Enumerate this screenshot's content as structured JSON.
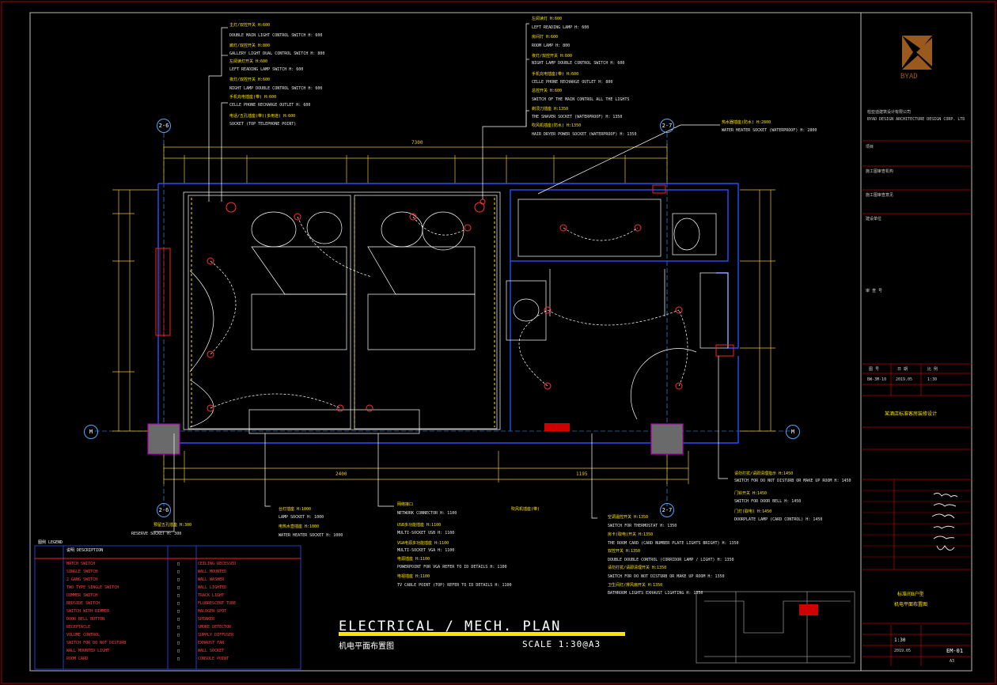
{
  "drawing": {
    "title_en": "ELECTRICAL / MECH. PLAN",
    "title_cn": "机电平面布置图",
    "scale": "SCALE 1:30@A3"
  },
  "grid_labels": {
    "top_left": "2-6",
    "top_right": "2-7",
    "bottom_left": "2-6",
    "bottom_right": "2-7",
    "left_m": "M",
    "right_m": "M"
  },
  "dimensions": {
    "top_total": "7300",
    "bottom_mid": "2400",
    "bottom_right": "1195"
  },
  "callouts_top_left": [
    {
      "cn": "主灯/双控开关 H:600",
      "en": "DOUBLE MAIN LIGHT CONTROL SWITCH H: 600"
    },
    {
      "cn": "廊灯/双控开关 H:800",
      "en": "GALLERY LIGHT DUAL CONTROL SWITCH H: 800"
    },
    {
      "cn": "左阅读灯开关 H:600",
      "en": "LEFT READING LAMP SWITCH H: 600"
    },
    {
      "cn": "夜灯/双控开关 H:600",
      "en": "NIGHT LAMP DOUBLE CONTROL SWITCH H: 600"
    },
    {
      "cn": "手机充电插座(带) H:600",
      "en": "CELLE PHONE RECHARGE OUTLET H: 600"
    },
    {
      "cn": "电话/五孔插座(带)(多用途) H:600",
      "en": "SOCKET (TOP TELEPHONE POINT)"
    }
  ],
  "callouts_top_right": [
    {
      "cn": "左阅读灯 H:600",
      "en": "LEFT READING LAMP H: 600"
    },
    {
      "cn": "房间灯 H:600",
      "en": "ROOM LAMP H: 800"
    },
    {
      "cn": "夜灯/双控开关 H:600",
      "en": "NIGHT LAMP DOUBLE CONTROL SWITCH H: 600"
    },
    {
      "cn": "手机充电插座(带) H:600",
      "en": "CELLE PHONE RECHARGE OUTLET H: 800"
    },
    {
      "cn": "总控开关 H:600",
      "en": "SWITCH OF THE MAIN CONTROL ALL THE LIGHTS"
    },
    {
      "cn": "剃须刀插座 H:1350",
      "en": "THE SHAVER SOCKET (WATERPROOF) H: 1350"
    },
    {
      "cn": "吹风机插座(防水) H:1350",
      "en": "HAIR DRYER POWER SOCKET (WATERPROOF) H: 1350"
    }
  ],
  "callout_water_heater": {
    "cn": "热水器插座(防水) H:2800",
    "en": "WATER HEATER SOCKET (WATERPROOF) H: 2800"
  },
  "callout_reserve": {
    "cn": "预留五孔插座 H:300",
    "en": "RESERVE SOCKET H: 300"
  },
  "callouts_bottom_mid_left": [
    {
      "cn": "台灯插座 H:1000",
      "en": "LAMP SOCKET H: 1000"
    },
    {
      "cn": "电热水壶插座 H:1000",
      "en": "WATER HEATER SOCKET H: 1000"
    }
  ],
  "callouts_bottom_mid": [
    {
      "cn": "网络接口",
      "en": "NETWORK CONNECTOR H: 1100"
    },
    {
      "cn": "USB多功能插座 H:1100",
      "en": "MULTI-SOCKET USB H: 1100"
    },
    {
      "cn": "VGA电源多功能插座 H:1100",
      "en": "MULTI-SOCKET VGA H: 1100"
    },
    {
      "cn": "电源插座 H:1100",
      "en": "POWERPOINT FOR VGA REFER TO ID DETAILS H: 1100"
    },
    {
      "cn": "电视插座 H:1100",
      "en": "TV CABLE POINT (TOP) REFER TO ID DETAILS H: 1100"
    }
  ],
  "callout_bath_note": "吹风机插座(带)",
  "callouts_bottom_right": [
    {
      "cn": "空调温控开关 H:1350",
      "en": "SWITCH FOR THERMOSTAT H: 1350"
    },
    {
      "cn": "房卡(取电)开关 H:1350",
      "en": "THE ROOM CARD (CARD NUMBER PLATE LIGHTS BRIGHT) H: 1350"
    },
    {
      "cn": "双控开关 H:1350",
      "en": "DOUBLE DOUBLE CONTROL (CORRIDOR LAMP / LIGHT) H: 1350"
    },
    {
      "cn": "请勿打扰/请即清理开关 H:1350",
      "en": "SWITCH FOR DO NOT DISTURB OR MAKE UP ROOM H: 1350"
    },
    {
      "cn": "卫生间灯/排风扇开关 H:1350",
      "en": "BATHROOM LIGHTS EXHAUST LIGHTING H: 1350"
    }
  ],
  "callouts_far_right": [
    {
      "cn": "请勿打扰/请即清理指示 H:1450",
      "en": "SWITCH FOR DO NOT DISTURB OR MAKE UP ROOM H: 1450"
    },
    {
      "cn": "门铃开关 H:1450",
      "en": "SWITCH FOR DOOR BELL H: 1450"
    },
    {
      "cn": "门灯(取电) H:1450",
      "en": "DOORPLATE LAMP (CARD CONTROL) H: 1450"
    }
  ],
  "legend": {
    "head_left": [
      "图例 LEGEND",
      "说明 DESCRIPTION"
    ],
    "rows_left": [
      "MATCH SWITCH",
      "SINGLE SWITCH",
      "2 GANG SWITCH",
      "TWO TYPE SINGLE SWITCH",
      "DIMMER SWITCH",
      "BEDSIDE SWITCH",
      "SWITCH WITH DIMMER",
      "DOOR BELL BUTTON",
      "RECEPTACLE",
      "VOLUME CONTROL",
      "SWITCH FOR DO NOT DISTURB",
      "WALL MOUNTED LIGHT",
      "ROOM CARD"
    ],
    "rows_right": [
      "CEILING RECESSED",
      "WALL MOUNTED",
      "WALL WASHER",
      "WALL LIGHTED",
      "TRACK LIGHT",
      "FLUORESCENT TUBE",
      "HALOGEN SPOT",
      "SPEAKER",
      "SMOKE DETECTOR",
      "SUPPLY DIFFUSER",
      "EXHAUST FAN",
      "WALL SOCKET",
      "CONSOLE POINT"
    ]
  },
  "title_block": {
    "brand": "BYAD",
    "company": "柏亚迪建筑设计有限公司",
    "company_en": "BYAD DESIGN ARCHITECTURE DESIGN CORP. LTD",
    "rows": [
      "项目",
      "施工图审查机构",
      "施工图审查意见",
      "建设单位",
      "审 查 号"
    ],
    "date_header": [
      "图 号",
      "日 期",
      "比 例"
    ],
    "date_values": [
      "BW-3M-10",
      "2019.05",
      "1:30"
    ],
    "project_name": "某酒店标准客房装修设计",
    "drawing_name_1": "标准间B户型",
    "drawing_name_2": "机电平面布置图",
    "sheet_scale": "1:30",
    "sheet_date": "2019.05",
    "sheet_no": "EM-01",
    "sheet_size": "A3"
  },
  "colors": {
    "wall": "#2a4dff",
    "dimension": "#e8c22e",
    "callout": "#ffe400",
    "fixture": "#ff3030",
    "furniture": "#ffffff",
    "frame": "#c00000"
  }
}
